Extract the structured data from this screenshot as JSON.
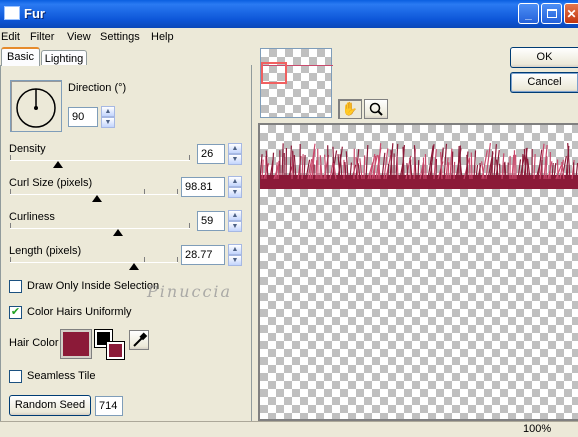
{
  "window": {
    "title": "Fur"
  },
  "menu": [
    "Edit",
    "Filter",
    "View",
    "Settings",
    "Help"
  ],
  "tabs": [
    {
      "label": "Basic"
    },
    {
      "label": "Lighting"
    }
  ],
  "direction": {
    "label": "Direction (°)",
    "value": "90"
  },
  "density": {
    "label": "Density",
    "value": "26",
    "level": 0.26
  },
  "curl_size": {
    "label": "Curl Size (pixels)",
    "value": "98.81",
    "level": 0.49
  },
  "curliness": {
    "label": "Curliness",
    "value": "59",
    "level": 0.59
  },
  "length": {
    "label": "Length (pixels)",
    "value": "28.77",
    "level": 0.72
  },
  "draw_inside": {
    "label": "Draw Only Inside Selection",
    "checked": false
  },
  "color_uniform": {
    "label": "Color Hairs Uniformly",
    "checked": true
  },
  "hair_color": {
    "label": "Hair Color",
    "color": "#8b1a38"
  },
  "seamless": {
    "label": "Seamless Tile",
    "checked": false
  },
  "random_seed": {
    "button": "Random Seed",
    "value": "714"
  },
  "watermark": "Pinuccia",
  "buttons": {
    "ok": "OK",
    "cancel": "Cancel"
  },
  "status": {
    "zoom": "100%"
  },
  "colors": {
    "fur": "#8b1a38",
    "fur_light": "#c94a6c"
  }
}
